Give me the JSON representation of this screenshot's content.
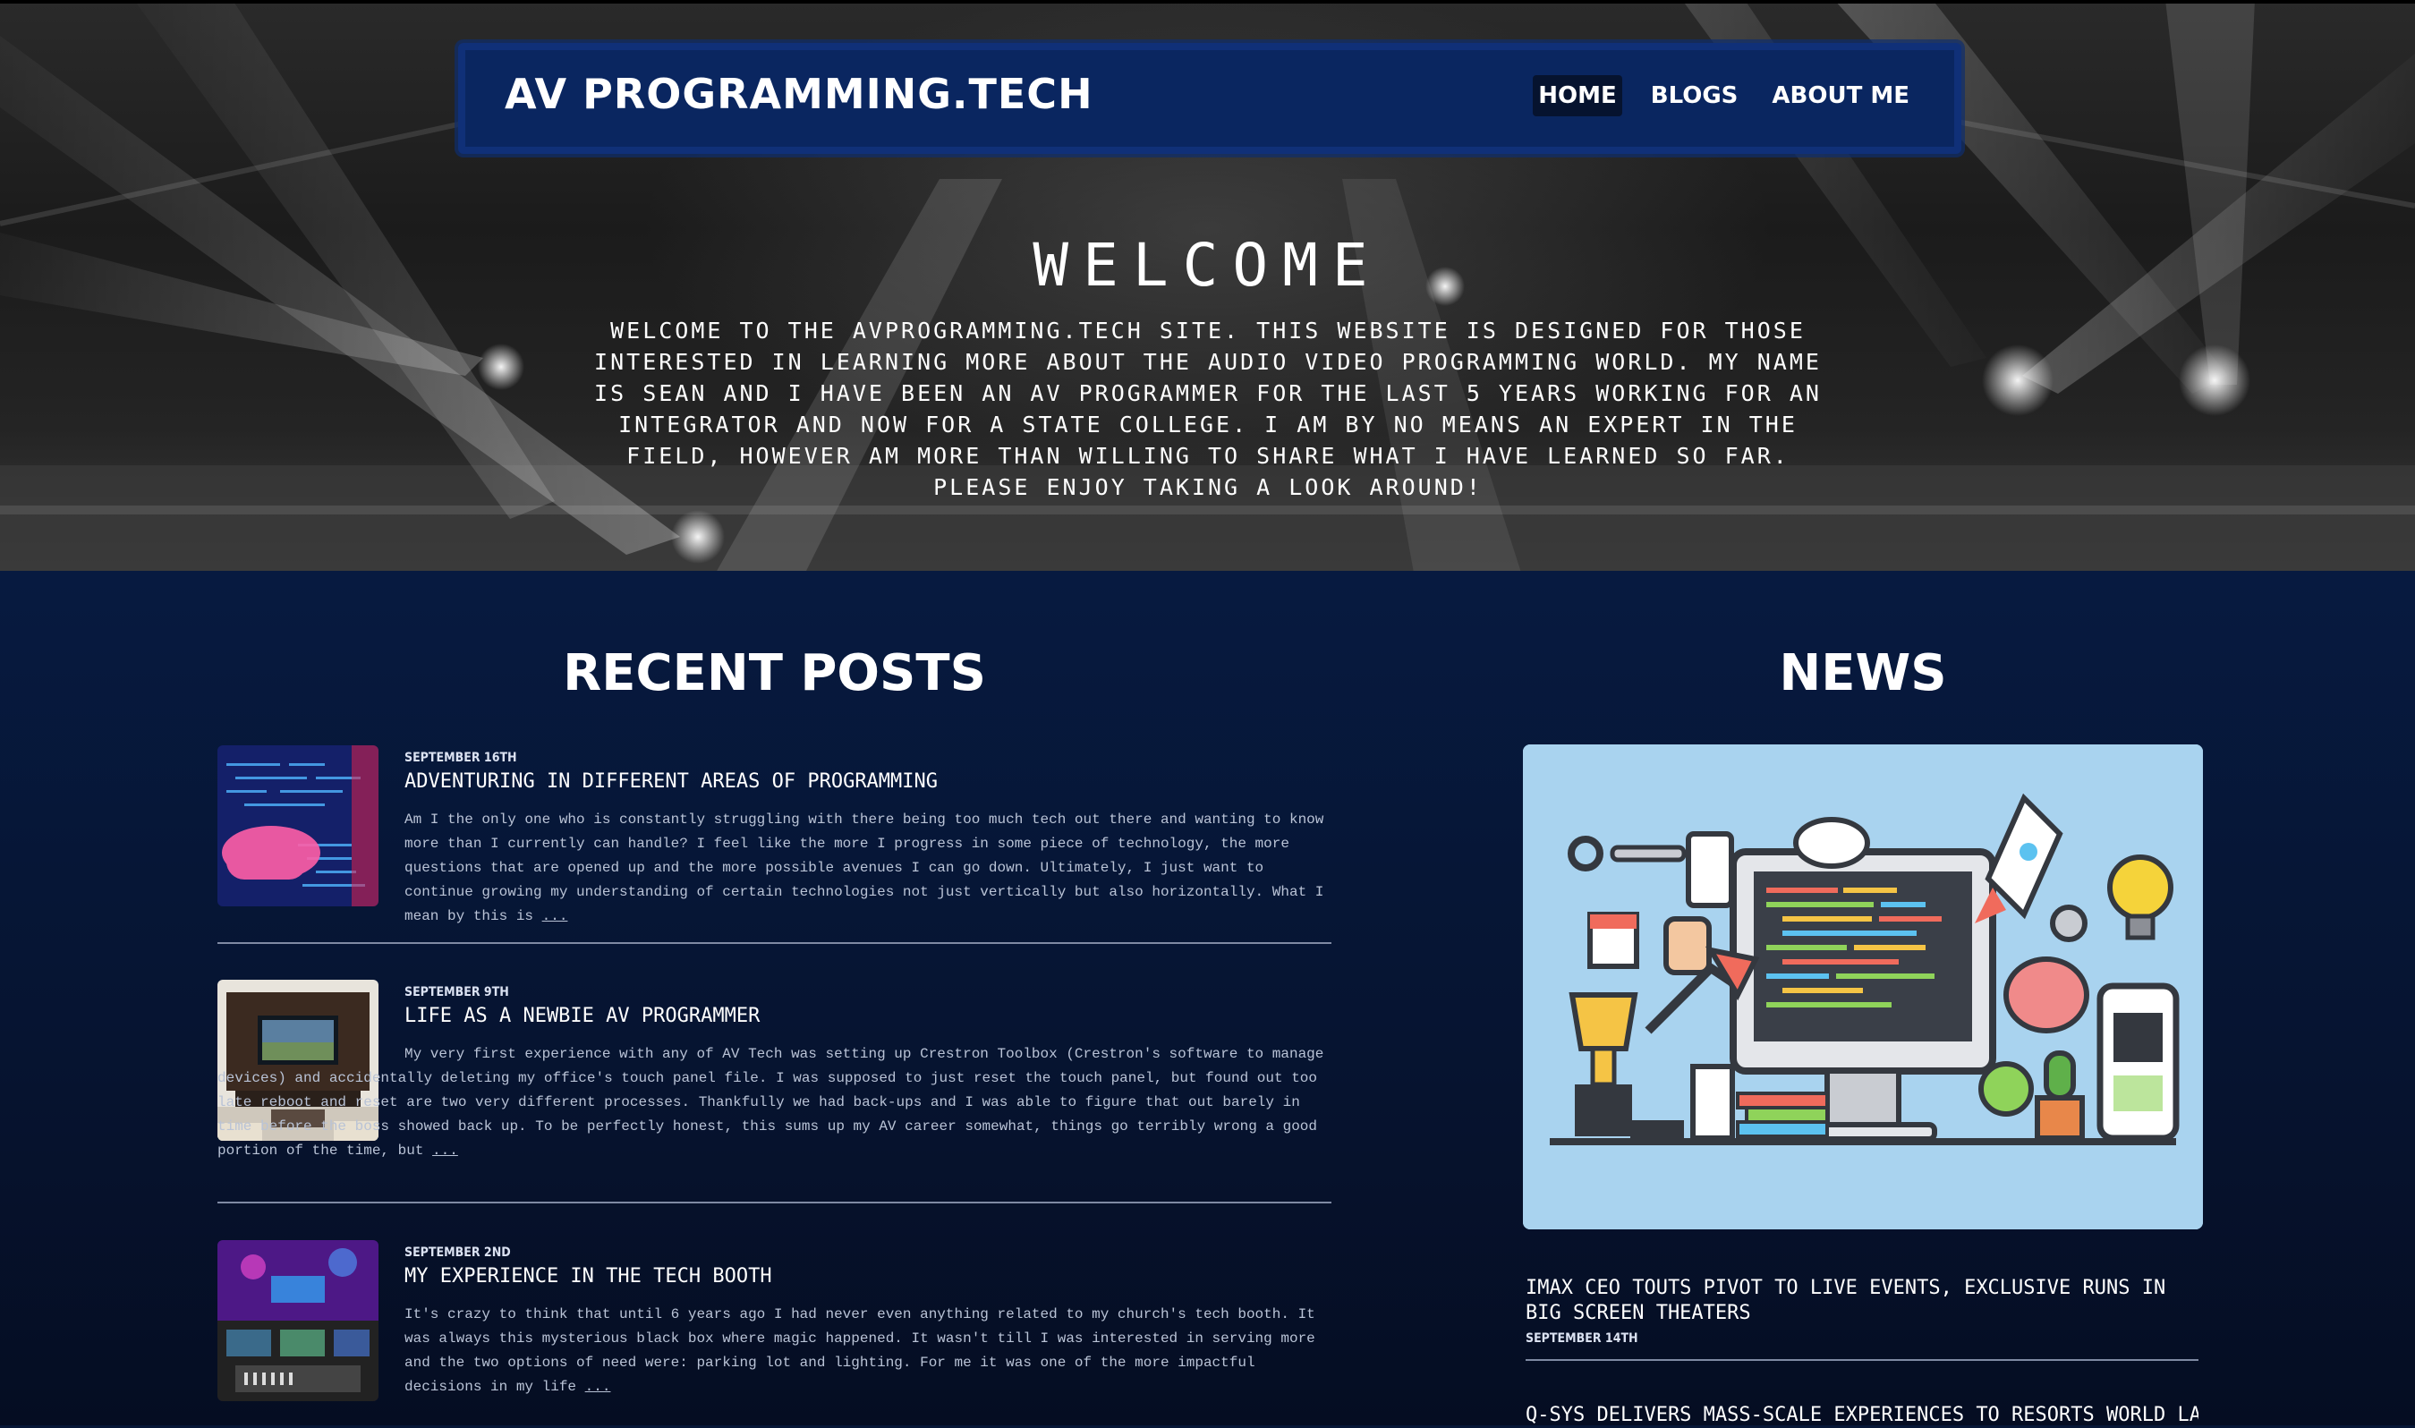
{
  "site": {
    "brand": "AV PROGRAMMING.TECH",
    "nav": [
      {
        "label": "HOME",
        "active": true
      },
      {
        "label": "BLOGS",
        "active": false
      },
      {
        "label": "ABOUT ME",
        "active": false
      }
    ]
  },
  "hero": {
    "title": "WELCOME",
    "text": "Welcome to the avprogramming.tech site. This website is designed for those interested in learning more about the audio video programming world. My name is Sean and I have been an AV programmer for the last 5 years working for an integrator and now for a state college. I am by no means an expert in the field, however am more than willing to share what I have learned so far. Please enjoy taking a look around!"
  },
  "recent_posts": {
    "heading": "RECENT POSTS",
    "posts": [
      {
        "date": "September 16th",
        "title": "Adventuring in Different Areas of Programming",
        "excerpt": "Am I the only one who is constantly struggling with there being too much tech out there and wanting to know more than I currently can handle? I feel like the more I progress in some piece of technology, the more questions that are opened up and the more possible avenues I can go down. Ultimately, I just want to continue growing my understanding of certain technologies not just vertically but also horizontally. What I mean by this is ",
        "more": "...",
        "thumb": "code-on-screen-image"
      },
      {
        "date": "September 9th",
        "title": "Life as a Newbie AV Programmer",
        "excerpt": "My very first experience with any of AV Tech was setting up Crestron Toolbox (Crestron's software to manage devices) and accidentally deleting my office's touch panel file. I was supposed to just reset the touch panel, but found out too late reboot and reset are two very different processes. Thankfully we had back-ups and I was able to figure that out barely in time before the boss showed back up. To be perfectly honest, this sums up my AV career somewhat, things go terribly wrong a good portion of the time, but ",
        "more": "...",
        "thumb": "living-room-tv-image"
      },
      {
        "date": "September 2nd",
        "title": "My Experience in the Tech Booth",
        "excerpt": "It's crazy to think that until 6 years ago I had never even anything related to my church's tech booth. It was always this mysterious black box where magic happened. It wasn't till I was interested in serving more and the two options of need were: parking lot and lighting. For me it was one of the more impactful decisions in my life ",
        "more": "...",
        "thumb": "tech-booth-image"
      }
    ]
  },
  "news": {
    "heading": "NEWS",
    "image": "programming-illustration",
    "items": [
      {
        "title": "IMAX CEO Touts Pivot to Live Events, Exclusive Runs in Big Screen Theaters",
        "date": "September 14th"
      },
      {
        "title": "Q-SYS Delivers Mass-Scale Experiences to Resorts World Las",
        "date": ""
      }
    ]
  },
  "colors": {
    "nav_bg": "#0a2660",
    "main_bg": "#071a40",
    "news_image_bg": "#a9d3ef"
  }
}
